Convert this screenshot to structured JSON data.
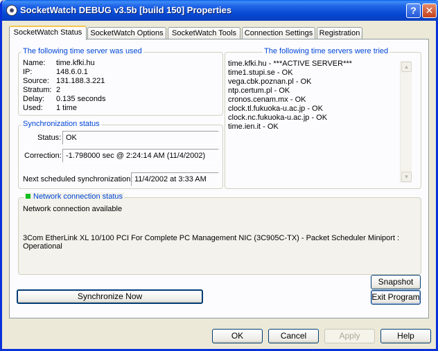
{
  "window": {
    "title": "SocketWatch DEBUG v3.5b [build 150] Properties",
    "help_glyph": "?",
    "close_glyph": "✕"
  },
  "tabs": [
    {
      "label": "SocketWatch Status",
      "active": true
    },
    {
      "label": "SocketWatch Options"
    },
    {
      "label": "SocketWatch Tools"
    },
    {
      "label": "Connection Settings"
    },
    {
      "label": "Registration"
    }
  ],
  "used_server": {
    "title": "The following time server was used",
    "rows": [
      {
        "label": "Name:",
        "value": "time.kfki.hu"
      },
      {
        "label": "IP:",
        "value": "148.6.0.1"
      },
      {
        "label": "Source:",
        "value": "131.188.3.221"
      },
      {
        "label": "Stratum:",
        "value": "2"
      },
      {
        "label": "Delay:",
        "value": "0.135 seconds"
      },
      {
        "label": "Used:",
        "value": "1 time"
      }
    ]
  },
  "tried_servers": {
    "title": "The following time servers were tried",
    "items": [
      "time.kfki.hu - ***ACTIVE SERVER***",
      "time1.stupi.se - OK",
      "vega.cbk.poznan.pl - OK",
      "ntp.certum.pl - OK",
      "cronos.cenam.mx - OK",
      "clock.tl.fukuoka-u.ac.jp - OK",
      "clock.nc.fukuoka-u.ac.jp - OK",
      "time.ien.it - OK"
    ],
    "scroll_up": "▲",
    "scroll_down": "▼"
  },
  "sync": {
    "title": "Synchronization status",
    "status_label": "Status:",
    "status_value": "OK",
    "correction_label": "Correction:",
    "correction_value": "-1.798000 sec @ 2:24:14 AM (11/4/2002)",
    "next_label": "Next scheduled synchronization:",
    "next_value": "11/4/2002 at 3:33 AM"
  },
  "network": {
    "title": "Network connection status",
    "indicator_color": "#0fbf1f",
    "line1": "Network connection available",
    "adapter": "3Com EtherLink XL 10/100 PCI For Complete PC Management NIC (3C905C-TX) - Packet Scheduler Miniport :",
    "adapter_state": "Operational"
  },
  "buttons": {
    "snapshot": "Snapshot",
    "synchronize": "Synchronize Now",
    "exit": "Exit Program",
    "ok": "OK",
    "cancel": "Cancel",
    "apply": "Apply",
    "help": "Help"
  }
}
